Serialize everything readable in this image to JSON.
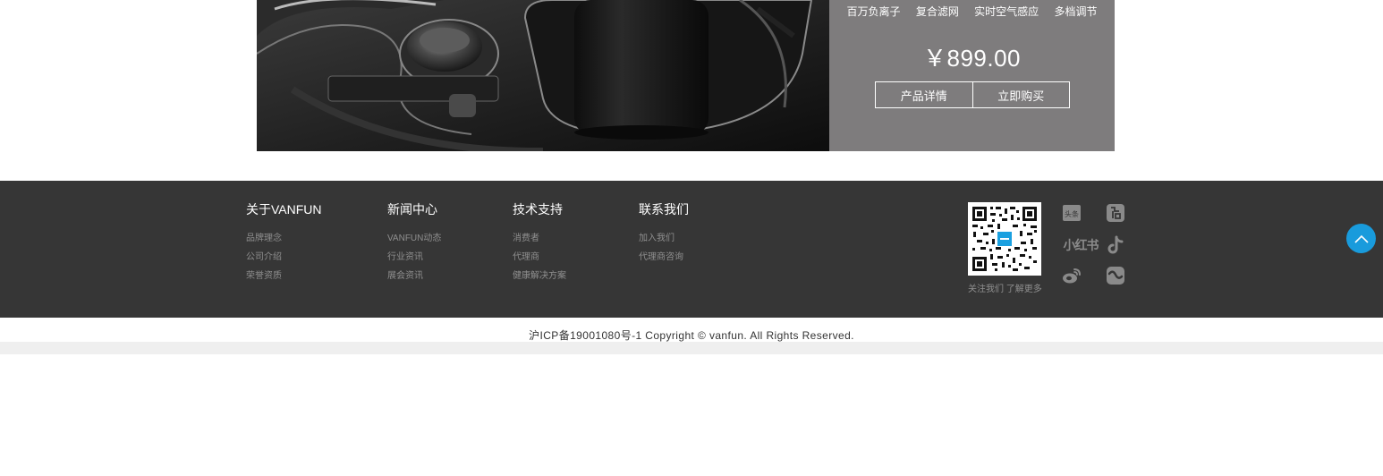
{
  "product": {
    "features": [
      "百万负离子",
      "复合滤网",
      "实时空气感应",
      "多档调节"
    ],
    "price": "￥899.00",
    "detail_button": "产品详情",
    "buy_button": "立即购买"
  },
  "footer": {
    "columns": [
      {
        "title": "关于VANFUN",
        "links": [
          "品牌理念",
          "公司介绍",
          "荣誉资质"
        ]
      },
      {
        "title": "新闻中心",
        "links": [
          "VANFUN动态",
          "行业资讯",
          "展会资讯"
        ]
      },
      {
        "title": "技术支持",
        "links": [
          "消费者",
          "代理商",
          "健康解决方案"
        ]
      },
      {
        "title": "联系我们",
        "links": [
          "加入我们",
          "代理商咨询"
        ]
      }
    ],
    "qr_caption": "关注我们 了解更多",
    "social": {
      "toutiao_label": "头条",
      "xiaohongshu_label": "小红书",
      "icons": [
        "toutiao-icon",
        "baijiahao-icon",
        "xiaohongshu-icon",
        "douyin-icon",
        "weibo-icon",
        "bilibili-like-icon"
      ]
    }
  },
  "copyright": "沪ICP备19001080号-1 Copyright © vanfun. All Rights Reserved.",
  "colors": {
    "product_info_bg": "#7e7c7d",
    "footer_bg": "#363636",
    "back_to_top": "#199bdc",
    "footer_link": "#8f8f8f"
  }
}
